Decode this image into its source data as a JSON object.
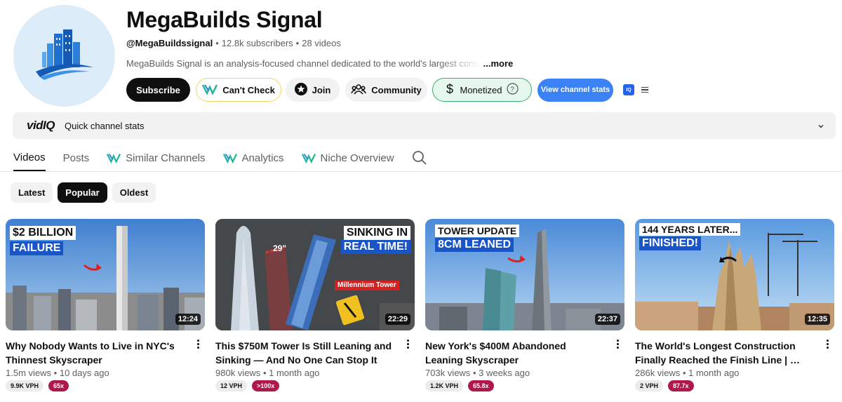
{
  "channel": {
    "name": "MegaBuilds Signal",
    "handle": "@MegaBuildssignal",
    "subscribers": "12.8k subscribers",
    "videos_count": "28 videos",
    "separator": "•",
    "description": "MegaBuilds Signal is an analysis-focused channel dedicated to the world's largest construction",
    "more_label": "...more"
  },
  "actions": {
    "subscribe": "Subscribe",
    "cant_check": "Can't Check",
    "join": "Join",
    "community": "Community",
    "monetized": "Monetized",
    "view_stats": "View channel stats",
    "vidiq_small": "IQ"
  },
  "quick_stats": {
    "logo": "vidIQ",
    "label": "Quick channel stats"
  },
  "tabs": [
    {
      "label": "Videos"
    },
    {
      "label": "Posts"
    },
    {
      "label": "Similar Channels"
    },
    {
      "label": "Analytics"
    },
    {
      "label": "Niche Overview"
    }
  ],
  "chips": [
    {
      "label": "Latest"
    },
    {
      "label": "Popular"
    },
    {
      "label": "Oldest"
    }
  ],
  "videos": [
    {
      "overlay_lines": [
        "$2 BILLION",
        "FAILURE"
      ],
      "duration": "12:24",
      "title": "Why Nobody Wants to Live in NYC's Thinnest Skyscraper",
      "views": "1.5m views",
      "age": "10 days ago",
      "vph": "9.9K VPH",
      "multiplier": "65x"
    },
    {
      "overlay_lines": [
        "SINKING IN",
        "REAL TIME!"
      ],
      "extra_labels": [
        "29\"",
        "Millennium Tower"
      ],
      "duration": "22:29",
      "title": "This $750M Tower Is Still Leaning and Sinking — And No One Can Stop It",
      "views": "980k views",
      "age": "1 month ago",
      "vph": "12 VPH",
      "multiplier": ">100x"
    },
    {
      "overlay_lines": [
        "TOWER UPDATE",
        "8CM LEANED"
      ],
      "duration": "22:37",
      "title": "New York's $400M Abandoned Leaning Skyscraper",
      "views": "703k views",
      "age": "3 weeks ago",
      "vph": "1.2K VPH",
      "multiplier": "65.8x"
    },
    {
      "overlay_lines": [
        "144 YEARS LATER...",
        "FINISHED!"
      ],
      "duration": "12:35",
      "title": "The World's Longest Construction Finally Reached the Finish Line | …",
      "views": "286k views",
      "age": "1 month ago",
      "vph": "2 VPH",
      "multiplier": "87.7x"
    }
  ],
  "colors": {
    "subscribe_bg": "#0f0f0f",
    "view_stats_bg": "#3b82f6",
    "monetized_border": "#37b06b",
    "multiplier_badge": "#b0174b"
  }
}
